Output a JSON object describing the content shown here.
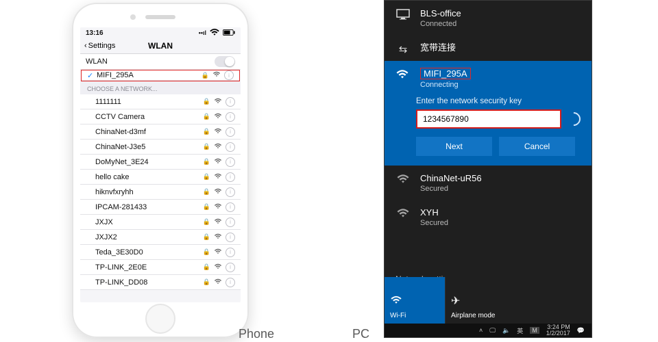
{
  "captions": {
    "phone": "Phone",
    "pc": "PC"
  },
  "phone": {
    "status_time": "13:16",
    "nav": {
      "back": "Settings",
      "title": "WLAN"
    },
    "wlan_label": "WLAN",
    "connected": {
      "name": "MIFI_295A"
    },
    "section_label": "CHOOSE A NETWORK...",
    "networks": [
      {
        "name": "1111111"
      },
      {
        "name": "CCTV Camera"
      },
      {
        "name": "ChinaNet-d3mf"
      },
      {
        "name": "ChinaNet-J3e5"
      },
      {
        "name": "DoMyNet_3E24"
      },
      {
        "name": "hello cake"
      },
      {
        "name": "hiknvfxryhh"
      },
      {
        "name": "IPCAM-281433"
      },
      {
        "name": "JXJX"
      },
      {
        "name": "JXJX2"
      },
      {
        "name": "Teda_3E30D0"
      },
      {
        "name": "TP-LINK_2E0E"
      },
      {
        "name": "TP-LINK_DD08"
      }
    ]
  },
  "pc": {
    "top_networks": [
      {
        "name": "BLS-office",
        "sub": "Connected",
        "icon": "monitor"
      },
      {
        "name": "宽带连接",
        "sub": "",
        "icon": "dialup"
      }
    ],
    "active": {
      "name": "MIFI_295A",
      "sub": "Connecting",
      "prompt": "Enter the network security key",
      "value": "1234567890",
      "next": "Next",
      "cancel": "Cancel"
    },
    "below_networks": [
      {
        "name": "ChinaNet-uR56",
        "sub": "Secured"
      },
      {
        "name": "XYH",
        "sub": "Secured"
      }
    ],
    "settings_link": "Network settings",
    "tiles": {
      "wifi": "Wi-Fi",
      "airplane": "Airplane mode"
    },
    "taskbar": {
      "ime1": "英",
      "ime2": "M",
      "time": "3:24 PM",
      "date": "1/2/2017"
    }
  }
}
